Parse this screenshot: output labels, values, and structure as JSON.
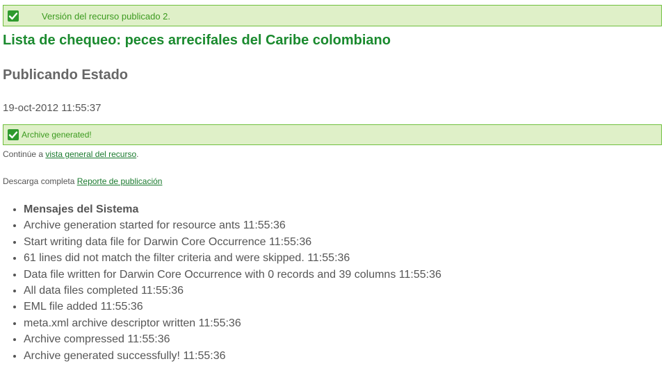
{
  "top_notice": {
    "text": "Versión del recurso publicado 2."
  },
  "title": "Lista de chequeo: peces arrecifales del Caribe colombiano",
  "subtitle": "Publicando Estado",
  "timestamp": "19-oct-2012 11:55:37",
  "archive_notice": {
    "text": "Archive generated!"
  },
  "continue_line": {
    "prefix": "Continúe a",
    "link_text": "vista general del recurso",
    "suffix": "."
  },
  "download_line": {
    "prefix": "Descarga completa",
    "link_text": "Reporte de publicación"
  },
  "system_messages": {
    "header": "Mensajes del Sistema",
    "items": [
      "Archive generation started for resource ants 11:55:36",
      "Start writing data file for Darwin Core Occurrence 11:55:36",
      "61 lines did not match the filter criteria and were skipped. 11:55:36",
      "Data file written for Darwin Core Occurrence with 0 records and 39 columns 11:55:36",
      "All data files completed 11:55:36",
      "EML file added 11:55:36",
      "meta.xml archive descriptor written 11:55:36",
      "Archive compressed 11:55:36",
      "Archive generated successfully! 11:55:36"
    ]
  },
  "colors": {
    "success_bg": "#dff0c8",
    "success_border": "#6fbf3d",
    "success_text": "#3c9a1f",
    "title": "#1a8a2e",
    "link": "#1a7a2e"
  },
  "icons": {
    "success": "checkmark-icon"
  }
}
